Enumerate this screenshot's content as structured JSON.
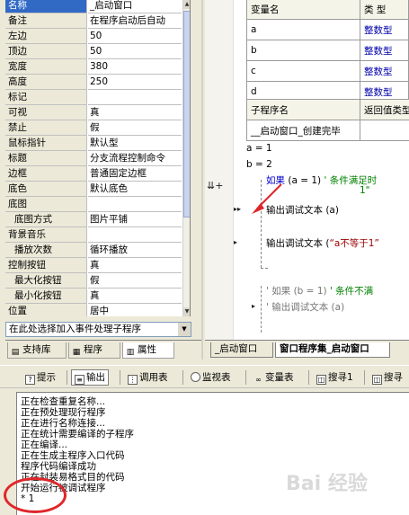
{
  "properties": [
    {
      "name": "名称",
      "value": "_启动窗口",
      "selected": true
    },
    {
      "name": "备注",
      "value": "在程序启动后自动"
    },
    {
      "name": "左边",
      "value": "50"
    },
    {
      "name": "顶边",
      "value": "50"
    },
    {
      "name": "宽度",
      "value": "380"
    },
    {
      "name": "高度",
      "value": "250"
    },
    {
      "name": "标记",
      "value": ""
    },
    {
      "name": "可视",
      "value": "真"
    },
    {
      "name": "禁止",
      "value": "假"
    },
    {
      "name": "鼠标指针",
      "value": "默认型"
    },
    {
      "name": "标题",
      "value": "分支流程控制命令"
    },
    {
      "name": "边框",
      "value": "普通固定边框"
    },
    {
      "name": "底色",
      "value": "默认底色"
    },
    {
      "name": "底图",
      "value": ""
    },
    {
      "name": "底图方式",
      "value": "图片平铺",
      "indent": true
    },
    {
      "name": "背景音乐",
      "value": ""
    },
    {
      "name": "播放次数",
      "value": "循环播放",
      "indent": true
    },
    {
      "name": "控制按钮",
      "value": "真"
    },
    {
      "name": "最大化按钮",
      "value": "假",
      "indent": true
    },
    {
      "name": "最小化按钮",
      "value": "真",
      "indent": true
    },
    {
      "name": "位置",
      "value": "居中"
    }
  ],
  "event_select": {
    "placeholder": "在此处选择加入事件处理子程序"
  },
  "left_tabs": [
    {
      "label": "支持库",
      "icon": "library-icon"
    },
    {
      "label": "程序",
      "icon": "program-icon"
    },
    {
      "label": "属性",
      "icon": "property-icon"
    }
  ],
  "code": {
    "var_header": {
      "name": "变量名",
      "type": "类 型"
    },
    "vars": [
      {
        "name": "a",
        "type": "整数型"
      },
      {
        "name": "b",
        "type": "整数型"
      },
      {
        "name": "c",
        "type": "整数型"
      },
      {
        "name": "d",
        "type": "整数型"
      }
    ],
    "sub_header": {
      "name": "子程序名",
      "ret": "返回值类型"
    },
    "sub_name": "__启动窗口_创建完毕",
    "lines": {
      "a_assign": "a = 1",
      "b_assign": "b = 2",
      "if1_kw": "如果",
      "if1_cond": "(a = 1)",
      "if1_comment": "' 条件满足时",
      "if1_comment2": "1\"",
      "out1": "输出调试文本 (a)",
      "out2_prefix": "输出调试文本 (",
      "out2_str": "“a不等于1”",
      "if2_kw": "' 如果",
      "if2_cond": "(b = 1)",
      "if2_comment": "' 条件不满",
      "out3": "' 输出调试文本 (a)"
    }
  },
  "code_tabs": [
    {
      "label": "_启动窗口",
      "active": false
    },
    {
      "label": "窗口程序集_启动窗口",
      "active": true
    }
  ],
  "output_tabs": [
    {
      "label": "提示",
      "icon": "hint-icon"
    },
    {
      "label": "输出",
      "icon": "output-icon",
      "active": true
    },
    {
      "label": "调用表",
      "icon": "calltable-icon"
    },
    {
      "label": "监视表",
      "icon": "watch-icon"
    },
    {
      "label": "变量表",
      "icon": "variables-icon"
    },
    {
      "label": "搜寻1",
      "icon": "search-icon"
    },
    {
      "label": "搜寻",
      "icon": "search-icon"
    }
  ],
  "output_lines": [
    "正在检查重复名称...",
    "正在预处理现行程序",
    "正在进行名称连接...",
    "正在统计需要编译的子程序",
    "正在编译...",
    "正在生成主程序入口代码",
    "程序代码编译成功",
    "正在封装易格式目的代码",
    "开始运行被调试程序",
    "* 1"
  ],
  "watermark": "Bai 经验",
  "colors": {
    "selection": "#316ac5",
    "keyword": "#0000cc",
    "comment": "#008000",
    "string": "#990000",
    "annotation": "#e0262a"
  }
}
